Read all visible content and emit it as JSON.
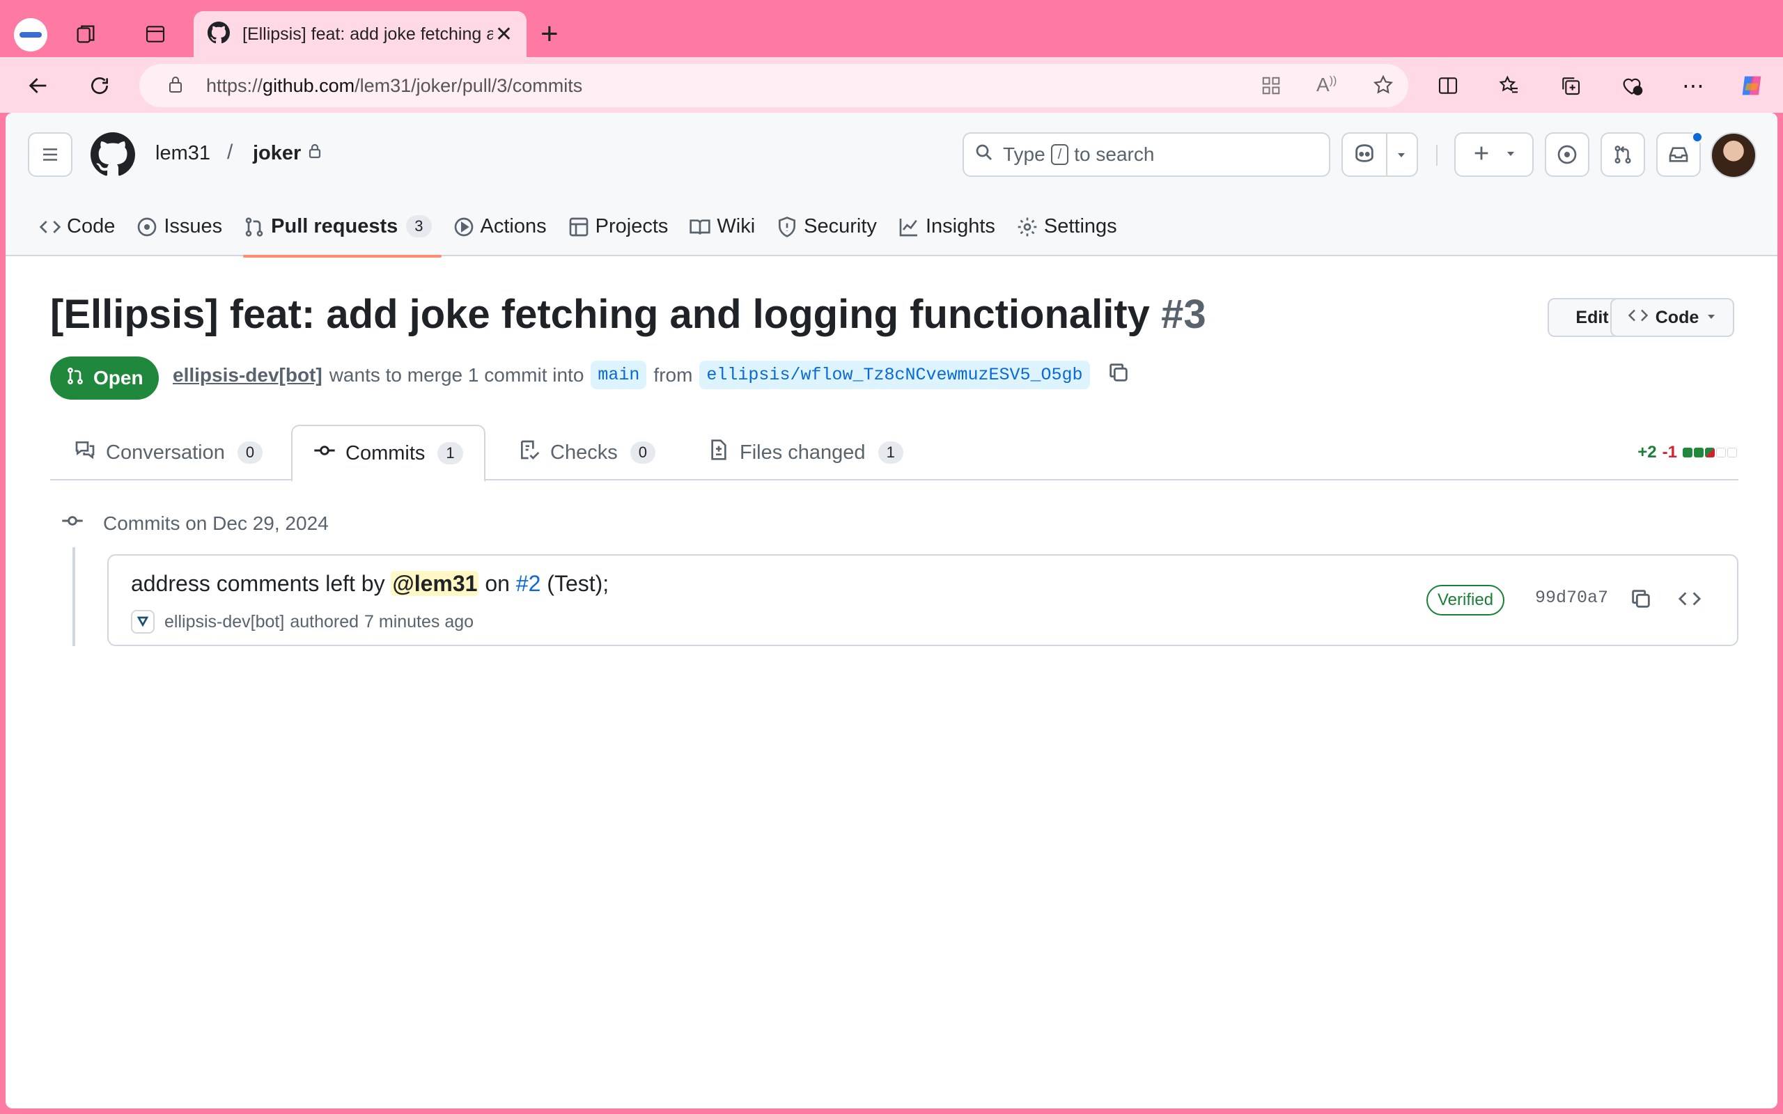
{
  "browser": {
    "tab_title": "[Ellipsis] feat: add joke fetching and logging functionality",
    "url_prefix": "https://",
    "url_host": "github.com",
    "url_path": "/lem31/joker/pull/3/commits"
  },
  "repo": {
    "owner": "lem31",
    "separator": "/",
    "name": "joker"
  },
  "search": {
    "prefix": "Type",
    "key": "/",
    "suffix": "to search"
  },
  "repo_nav": {
    "code": "Code",
    "issues": "Issues",
    "pull_requests": "Pull requests",
    "pull_requests_count": "3",
    "actions": "Actions",
    "projects": "Projects",
    "wiki": "Wiki",
    "security": "Security",
    "insights": "Insights",
    "settings": "Settings"
  },
  "pr": {
    "title": "[Ellipsis] feat: add joke fetching and logging functionality",
    "number": "#3",
    "edit_label": "Edit",
    "code_label": "Code",
    "state": "Open",
    "author": "ellipsis-dev[bot]",
    "merge_text": "wants to merge 1 commit into",
    "base_branch": "main",
    "from_text": "from",
    "head_branch": "ellipsis/wflow_Tz8cNCvewmuzESV5_O5gb"
  },
  "pr_tabs": {
    "conversation": "Conversation",
    "conversation_count": "0",
    "commits": "Commits",
    "commits_count": "1",
    "checks": "Checks",
    "checks_count": "0",
    "files": "Files changed",
    "files_count": "1",
    "additions": "+2",
    "deletions": "-1"
  },
  "commits": {
    "group_label": "Commits on Dec 29, 2024",
    "items": [
      {
        "msg_prefix": "address comments left by",
        "mention": "@lem31",
        "msg_mid": "on",
        "issue_ref": "#2",
        "msg_suffix": "(Test);",
        "author": "ellipsis-dev[bot]",
        "action": "authored",
        "time": "7 minutes ago",
        "verified": "Verified",
        "sha": "99d70a7"
      }
    ]
  },
  "colors": {
    "browser_accent": "#ff7aa3",
    "open_state": "#1f883d",
    "link": "#0969da"
  }
}
